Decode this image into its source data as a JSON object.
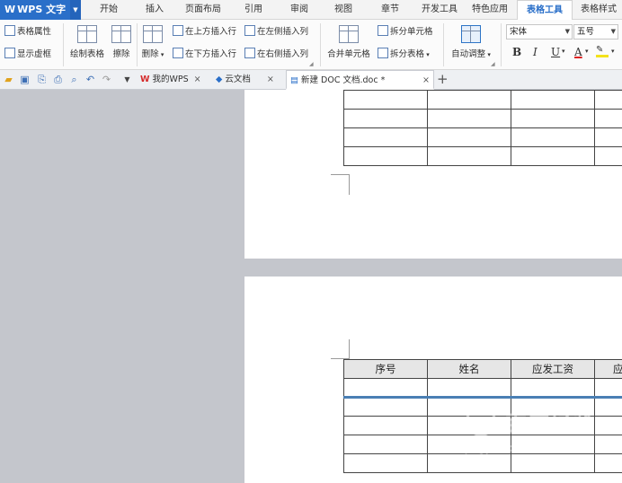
{
  "app": {
    "logo": "W",
    "title": "WPS 文字"
  },
  "menu": {
    "tabs": [
      "开始",
      "插入",
      "页面布局",
      "引用",
      "审阅",
      "视图",
      "章节",
      "开发工具",
      "特色应用",
      "表格工具",
      "表格样式"
    ],
    "active_tab": "表格工具"
  },
  "ribbon": {
    "table_props": "表格属性",
    "show_gridlines": "显示虚框",
    "draw_table": "绘制表格",
    "erase": "擦除",
    "delete": "删除",
    "insert_row_above": "在上方插入行",
    "insert_row_below": "在下方插入行",
    "insert_col_left": "在左侧插入列",
    "insert_col_right": "在右侧插入列",
    "merge_cells": "合并单元格",
    "split_cells": "拆分单元格",
    "split_table": "拆分表格",
    "auto_fit": "自动调整",
    "font_name": "宋体",
    "font_size": "五号",
    "bold": "B",
    "italic": "I",
    "underline": "U",
    "font_color": "A"
  },
  "doc_tabs": {
    "my_wps": "我的WPS",
    "cloud_docs": "云文档",
    "active_doc": "新建 DOC 文档.doc *"
  },
  "table": {
    "headers": [
      "序号",
      "姓名",
      "应发工资",
      "应"
    ]
  },
  "watermark": {
    "text": "百度经验",
    "url": "jingyan.baidu.com"
  },
  "colors": {
    "accent": "#2a6fc9",
    "table_header_bg": "#e6e6e6",
    "workspace_bg": "#c4c6cc"
  }
}
